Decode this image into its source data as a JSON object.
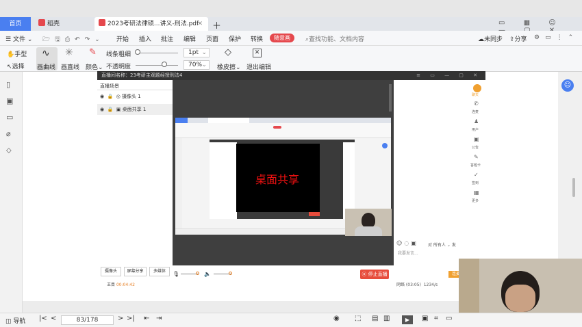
{
  "tabs": {
    "home": "首页",
    "brand": "稻壳",
    "doc": "2023考研法律硕...讲义-刑法.pdf"
  },
  "menu": {
    "file": "文件",
    "start": "开始",
    "insert": "插入",
    "annotate": "批注",
    "edit": "编辑",
    "page": "页面",
    "protect": "保护",
    "convert": "转换",
    "badge": "随意画",
    "search_placeholder": "查找功能、文档内容",
    "sync": "未同步",
    "share": "分享"
  },
  "tools": {
    "hand": "手型",
    "select": "选择",
    "draw_curve": "画曲线",
    "draw_line": "画直线",
    "color": "颜色",
    "line_weight": "线条粗细",
    "weight_val": "1pt",
    "opacity": "不透明度",
    "opacity_val": "70%",
    "eraser": "橡皮擦",
    "exit_edit": "退出编辑"
  },
  "live": {
    "title": "直播间名称：23考研主观题经授刑法4",
    "section": "直播场景",
    "scenes": [
      "摄像头 1",
      "桌面共享 1"
    ],
    "shared_label": "桌面共享",
    "buttons": [
      "摄像头",
      "屏幕分享",
      "多媒体"
    ],
    "stop": "停止直播",
    "timer_label": "王目",
    "timer": "00:04:42",
    "stats": "网络 (03:05)",
    "stats2": "1234/s",
    "chat_placeholder": "我要发言...",
    "chat_to": "所有人",
    "chat_send": "发",
    "side": [
      "聊天",
      "连麦",
      "用户",
      "公告",
      "答题卡",
      "签到",
      "更多"
    ],
    "side_btn": "连麦"
  },
  "status": {
    "nav": "导航",
    "page": "83/178"
  },
  "colors": {
    "accent": "#4a7ff0",
    "badge": "#e5484d",
    "live_orange": "#f0a030",
    "stop_red": "#e74c3c"
  }
}
